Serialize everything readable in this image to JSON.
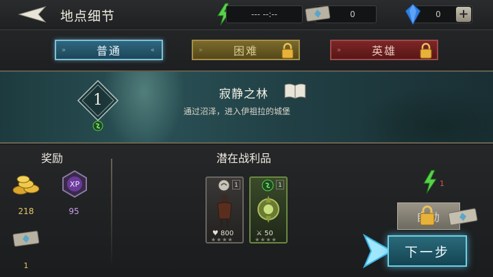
{
  "header": {
    "title": "地点细节",
    "energy_display": "---   --:--",
    "ticket_count": "0",
    "gem_count": "0",
    "plus_label": "+"
  },
  "difficulty": {
    "normal_label": "普通",
    "hard_label": "困难",
    "hero_label": "英雄",
    "selected": "普通"
  },
  "stage": {
    "level": "1",
    "title": "寂静之林",
    "description": "通过沼泽，进入伊祖拉的城堡"
  },
  "rewards": {
    "title": "奖励",
    "gold": "218",
    "xp": "95",
    "xp_label": "XP",
    "tickets": "1"
  },
  "loot": {
    "title": "潜在战利品",
    "items": [
      {
        "count": "1",
        "stat": "800",
        "stat_icon": "heart-icon"
      },
      {
        "count": "1",
        "stat": "50",
        "stat_icon": "swords-icon"
      }
    ]
  },
  "actions": {
    "energy_cost": "1",
    "auto_label": "自动",
    "next_label": "下一步"
  },
  "colors": {
    "normal_accent": "#7fc0d8",
    "hard_accent": "#a58f45",
    "hero_accent": "#9c4a4a",
    "next_glow": "#6fd0e8"
  }
}
